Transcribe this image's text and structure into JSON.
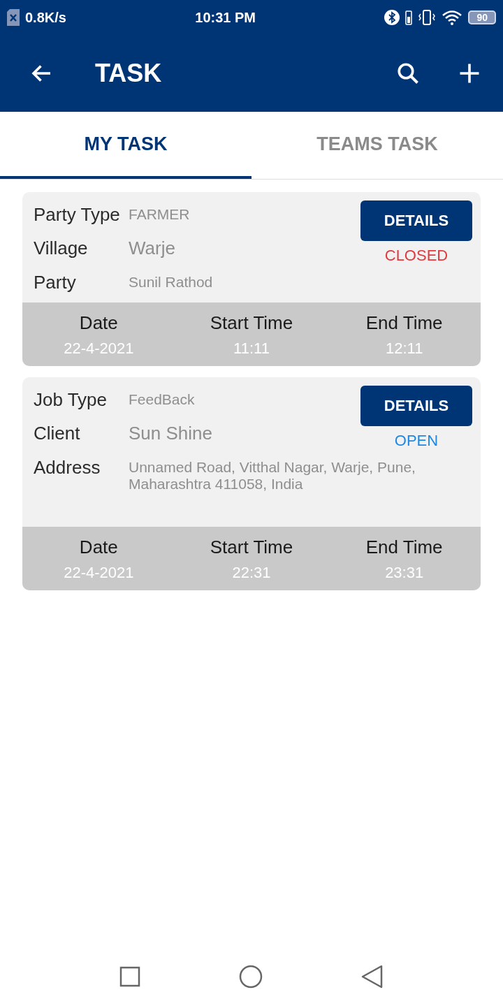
{
  "status_bar": {
    "speed": "0.8K/s",
    "time": "10:31 PM",
    "battery": "90"
  },
  "app_bar": {
    "title": "TASK"
  },
  "tabs": [
    {
      "label": "MY TASK",
      "selected": true
    },
    {
      "label": "TEAMS TASK",
      "selected": false
    }
  ],
  "tasks": [
    {
      "fields": [
        {
          "label": "Party Type",
          "value": "FARMER"
        },
        {
          "label": "Village",
          "value": "Warje"
        },
        {
          "label": "Party",
          "value": "Sunil Rathod"
        }
      ],
      "button": "DETAILS",
      "status": {
        "text": "CLOSED",
        "color": "#e0393e"
      },
      "columns": [
        {
          "heading": "Date",
          "value": "22-4-2021"
        },
        {
          "heading": "Start Time",
          "value": "11:11"
        },
        {
          "heading": "End Time",
          "value": "12:11"
        }
      ]
    },
    {
      "fields": [
        {
          "label": "Job Type",
          "value": "FeedBack"
        },
        {
          "label": "Client",
          "value": "Sun Shine"
        },
        {
          "label": "Address",
          "value": "Unnamed Road, Vitthal Nagar, Warje, Pune, Maharashtra 411058, India"
        }
      ],
      "button": "DETAILS",
      "status": {
        "text": "OPEN",
        "color": "#1e88e5"
      },
      "columns": [
        {
          "heading": "Date",
          "value": "22-4-2021"
        },
        {
          "heading": "Start Time",
          "value": "22:31"
        },
        {
          "heading": "End Time",
          "value": "23:31"
        }
      ]
    }
  ]
}
